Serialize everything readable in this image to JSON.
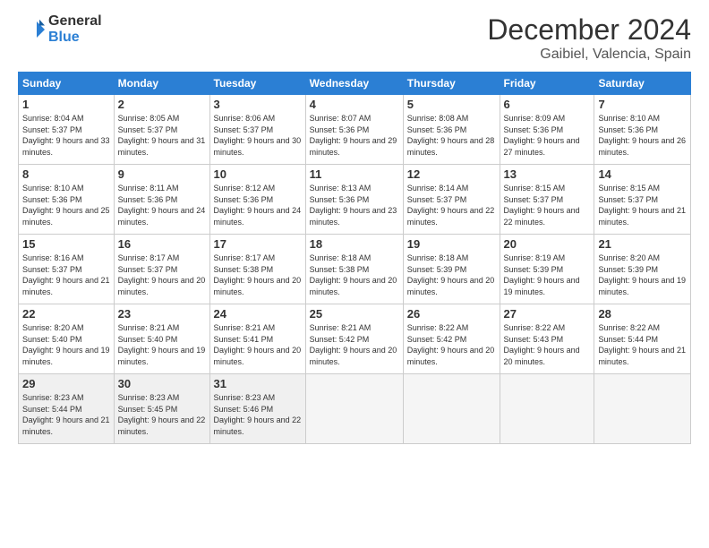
{
  "logo": {
    "general": "General",
    "blue": "Blue"
  },
  "title": {
    "month_year": "December 2024",
    "location": "Gaibiel, Valencia, Spain"
  },
  "headers": [
    "Sunday",
    "Monday",
    "Tuesday",
    "Wednesday",
    "Thursday",
    "Friday",
    "Saturday"
  ],
  "weeks": [
    [
      {
        "day": "1",
        "sunrise": "8:04 AM",
        "sunset": "5:37 PM",
        "daylight": "9 hours and 33 minutes."
      },
      {
        "day": "2",
        "sunrise": "8:05 AM",
        "sunset": "5:37 PM",
        "daylight": "9 hours and 31 minutes."
      },
      {
        "day": "3",
        "sunrise": "8:06 AM",
        "sunset": "5:37 PM",
        "daylight": "9 hours and 30 minutes."
      },
      {
        "day": "4",
        "sunrise": "8:07 AM",
        "sunset": "5:36 PM",
        "daylight": "9 hours and 29 minutes."
      },
      {
        "day": "5",
        "sunrise": "8:08 AM",
        "sunset": "5:36 PM",
        "daylight": "9 hours and 28 minutes."
      },
      {
        "day": "6",
        "sunrise": "8:09 AM",
        "sunset": "5:36 PM",
        "daylight": "9 hours and 27 minutes."
      },
      {
        "day": "7",
        "sunrise": "8:10 AM",
        "sunset": "5:36 PM",
        "daylight": "9 hours and 26 minutes."
      }
    ],
    [
      {
        "day": "8",
        "sunrise": "8:10 AM",
        "sunset": "5:36 PM",
        "daylight": "9 hours and 25 minutes."
      },
      {
        "day": "9",
        "sunrise": "8:11 AM",
        "sunset": "5:36 PM",
        "daylight": "9 hours and 24 minutes."
      },
      {
        "day": "10",
        "sunrise": "8:12 AM",
        "sunset": "5:36 PM",
        "daylight": "9 hours and 24 minutes."
      },
      {
        "day": "11",
        "sunrise": "8:13 AM",
        "sunset": "5:36 PM",
        "daylight": "9 hours and 23 minutes."
      },
      {
        "day": "12",
        "sunrise": "8:14 AM",
        "sunset": "5:37 PM",
        "daylight": "9 hours and 22 minutes."
      },
      {
        "day": "13",
        "sunrise": "8:15 AM",
        "sunset": "5:37 PM",
        "daylight": "9 hours and 22 minutes."
      },
      {
        "day": "14",
        "sunrise": "8:15 AM",
        "sunset": "5:37 PM",
        "daylight": "9 hours and 21 minutes."
      }
    ],
    [
      {
        "day": "15",
        "sunrise": "8:16 AM",
        "sunset": "5:37 PM",
        "daylight": "9 hours and 21 minutes."
      },
      {
        "day": "16",
        "sunrise": "8:17 AM",
        "sunset": "5:37 PM",
        "daylight": "9 hours and 20 minutes."
      },
      {
        "day": "17",
        "sunrise": "8:17 AM",
        "sunset": "5:38 PM",
        "daylight": "9 hours and 20 minutes."
      },
      {
        "day": "18",
        "sunrise": "8:18 AM",
        "sunset": "5:38 PM",
        "daylight": "9 hours and 20 minutes."
      },
      {
        "day": "19",
        "sunrise": "8:18 AM",
        "sunset": "5:39 PM",
        "daylight": "9 hours and 20 minutes."
      },
      {
        "day": "20",
        "sunrise": "8:19 AM",
        "sunset": "5:39 PM",
        "daylight": "9 hours and 19 minutes."
      },
      {
        "day": "21",
        "sunrise": "8:20 AM",
        "sunset": "5:39 PM",
        "daylight": "9 hours and 19 minutes."
      }
    ],
    [
      {
        "day": "22",
        "sunrise": "8:20 AM",
        "sunset": "5:40 PM",
        "daylight": "9 hours and 19 minutes."
      },
      {
        "day": "23",
        "sunrise": "8:21 AM",
        "sunset": "5:40 PM",
        "daylight": "9 hours and 19 minutes."
      },
      {
        "day": "24",
        "sunrise": "8:21 AM",
        "sunset": "5:41 PM",
        "daylight": "9 hours and 20 minutes."
      },
      {
        "day": "25",
        "sunrise": "8:21 AM",
        "sunset": "5:42 PM",
        "daylight": "9 hours and 20 minutes."
      },
      {
        "day": "26",
        "sunrise": "8:22 AM",
        "sunset": "5:42 PM",
        "daylight": "9 hours and 20 minutes."
      },
      {
        "day": "27",
        "sunrise": "8:22 AM",
        "sunset": "5:43 PM",
        "daylight": "9 hours and 20 minutes."
      },
      {
        "day": "28",
        "sunrise": "8:22 AM",
        "sunset": "5:44 PM",
        "daylight": "9 hours and 21 minutes."
      }
    ],
    [
      {
        "day": "29",
        "sunrise": "8:23 AM",
        "sunset": "5:44 PM",
        "daylight": "9 hours and 21 minutes."
      },
      {
        "day": "30",
        "sunrise": "8:23 AM",
        "sunset": "5:45 PM",
        "daylight": "9 hours and 22 minutes."
      },
      {
        "day": "31",
        "sunrise": "8:23 AM",
        "sunset": "5:46 PM",
        "daylight": "9 hours and 22 minutes."
      },
      null,
      null,
      null,
      null
    ]
  ]
}
